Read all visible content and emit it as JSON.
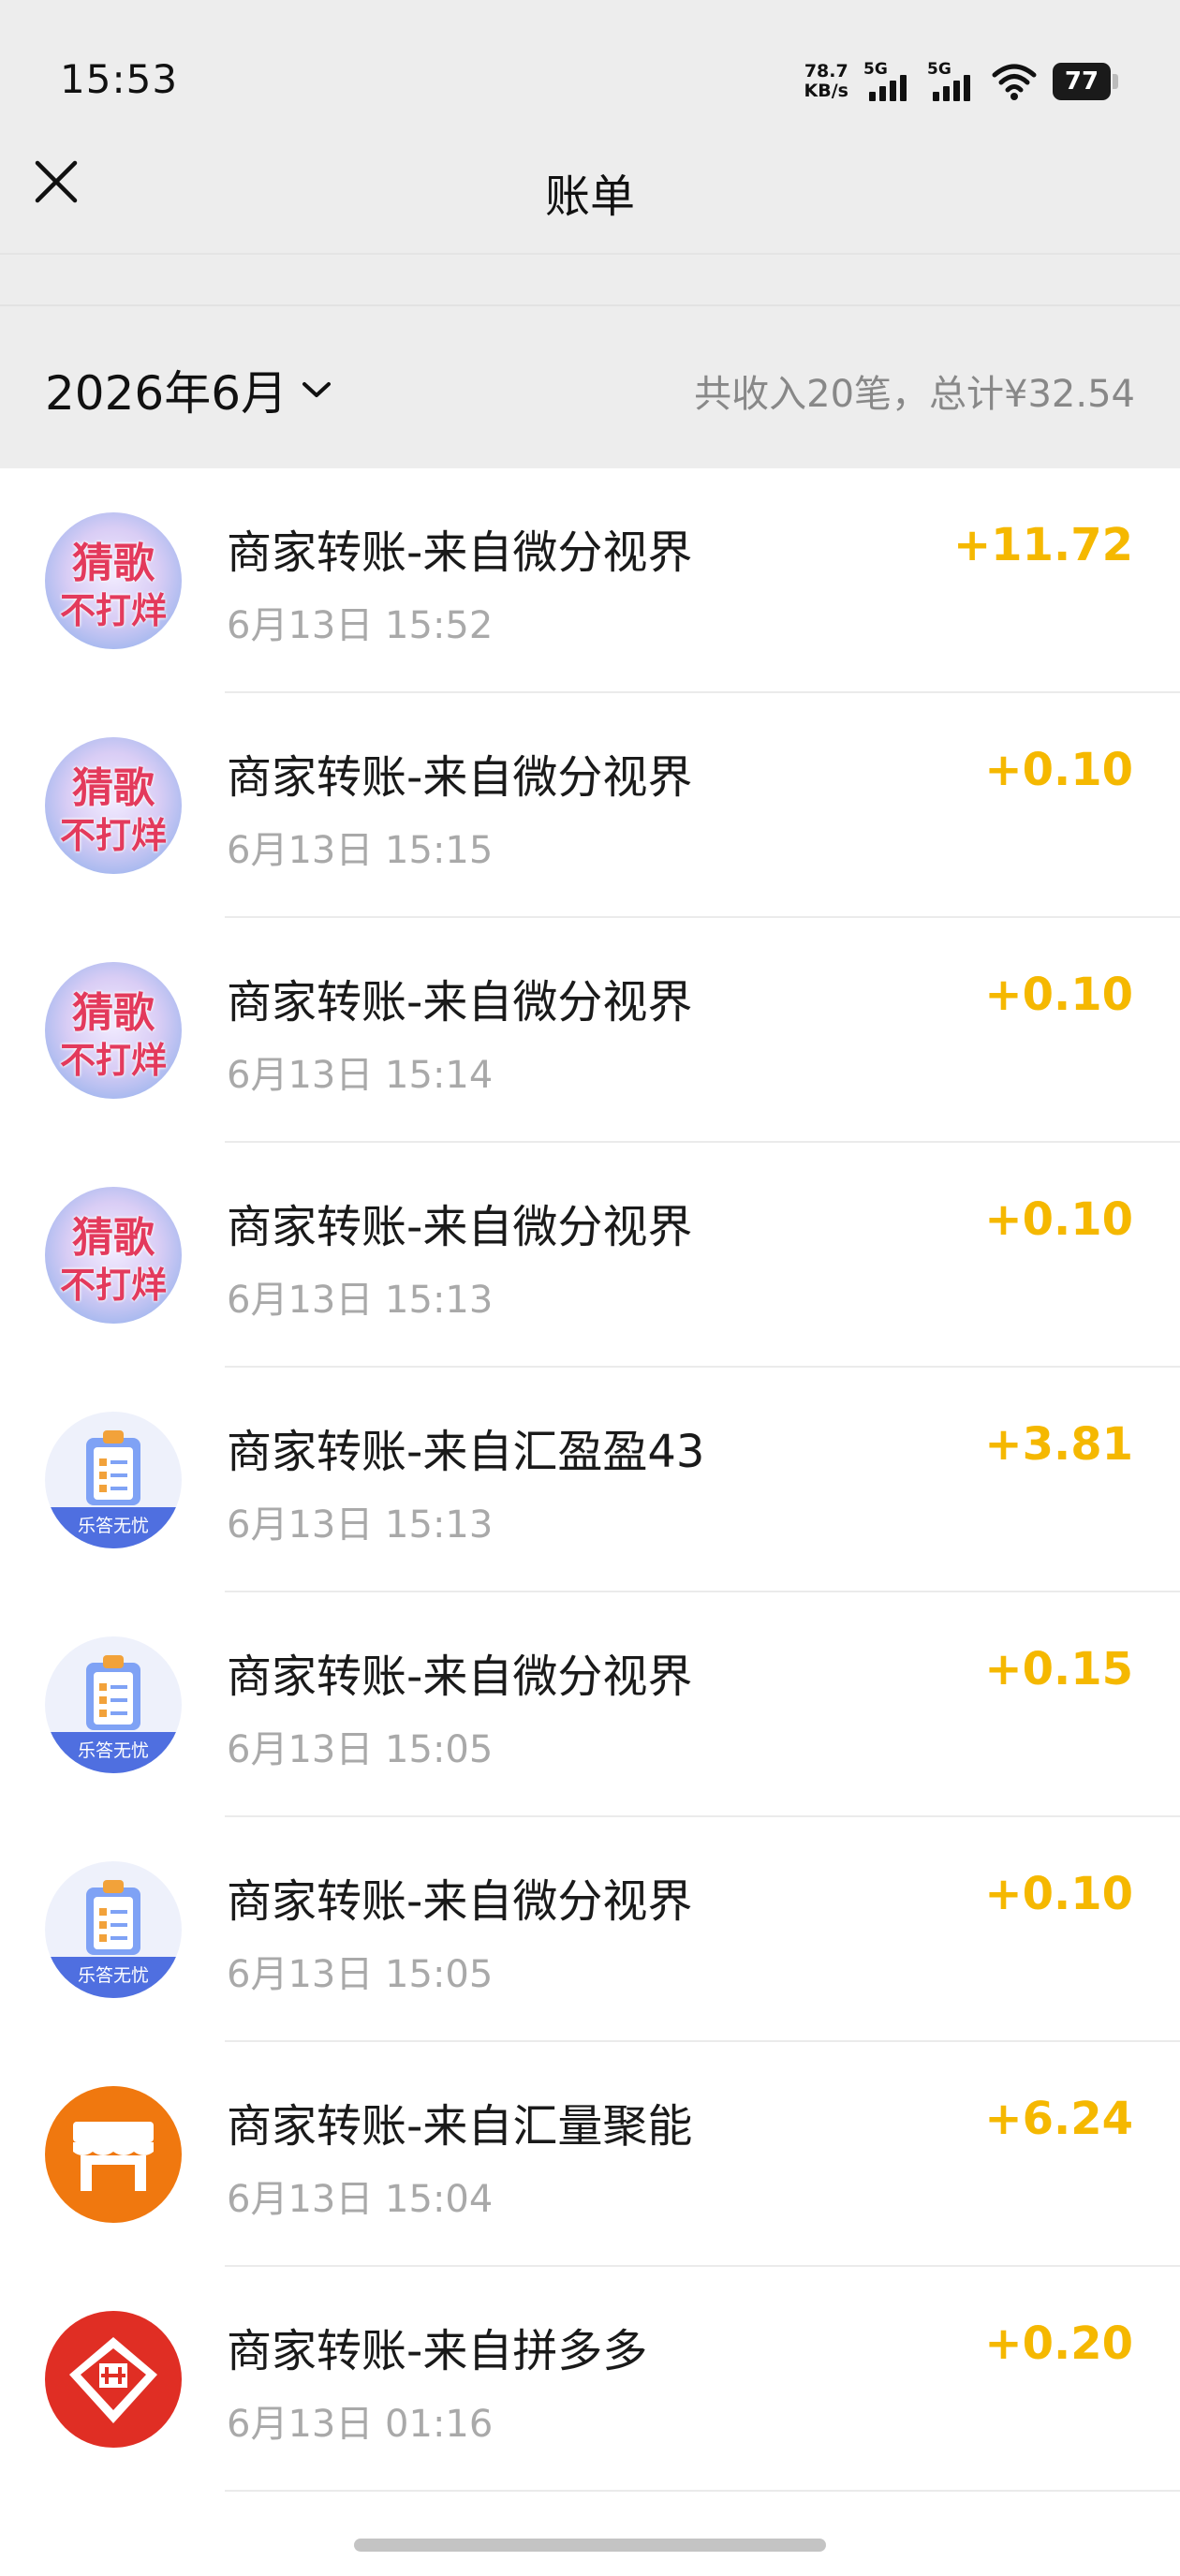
{
  "status": {
    "time": "15:53",
    "net_speed_value": "78.7",
    "net_speed_unit": "KB/s",
    "sim1": "5G",
    "sim2": "5G",
    "battery": "77"
  },
  "header": {
    "title": "账单"
  },
  "summary": {
    "month": "2026年6月",
    "total": "共收入20笔，总计¥32.54"
  },
  "transactions": [
    {
      "title": "商家转账-来自微分视界",
      "time": "6月13日 15:52",
      "amount": "+11.72",
      "icon": "song-guess-icon",
      "avatar_l1": "猜歌",
      "avatar_l2": "不打烊"
    },
    {
      "title": "商家转账-来自微分视界",
      "time": "6月13日 15:15",
      "amount": "+0.10",
      "icon": "song-guess-icon",
      "avatar_l1": "猜歌",
      "avatar_l2": "不打烊"
    },
    {
      "title": "商家转账-来自微分视界",
      "time": "6月13日 15:14",
      "amount": "+0.10",
      "icon": "song-guess-icon",
      "avatar_l1": "猜歌",
      "avatar_l2": "不打烊"
    },
    {
      "title": "商家转账-来自微分视界",
      "time": "6月13日 15:13",
      "amount": "+0.10",
      "icon": "song-guess-icon",
      "avatar_l1": "猜歌",
      "avatar_l2": "不打烊"
    },
    {
      "title": "商家转账-来自汇盈盈43",
      "time": "6月13日 15:13",
      "amount": "+3.81",
      "icon": "clipboard-quiz-icon",
      "avatar_caption": "乐答无忧"
    },
    {
      "title": "商家转账-来自微分视界",
      "time": "6月13日 15:05",
      "amount": "+0.15",
      "icon": "clipboard-quiz-icon",
      "avatar_caption": "乐答无忧"
    },
    {
      "title": "商家转账-来自微分视界",
      "time": "6月13日 15:05",
      "amount": "+0.10",
      "icon": "clipboard-quiz-icon",
      "avatar_caption": "乐答无忧"
    },
    {
      "title": "商家转账-来自汇量聚能",
      "time": "6月13日 15:04",
      "amount": "+6.24",
      "icon": "storefront-icon"
    },
    {
      "title": "商家转账-来自拼多多",
      "time": "6月13日 01:16",
      "amount": "+0.20",
      "icon": "pinduoduo-logo-icon"
    }
  ],
  "colors": {
    "amount": "#f5b800",
    "header_bg": "#ededed",
    "shop_orange": "#f0780f",
    "pdd_red": "#e02e24"
  }
}
